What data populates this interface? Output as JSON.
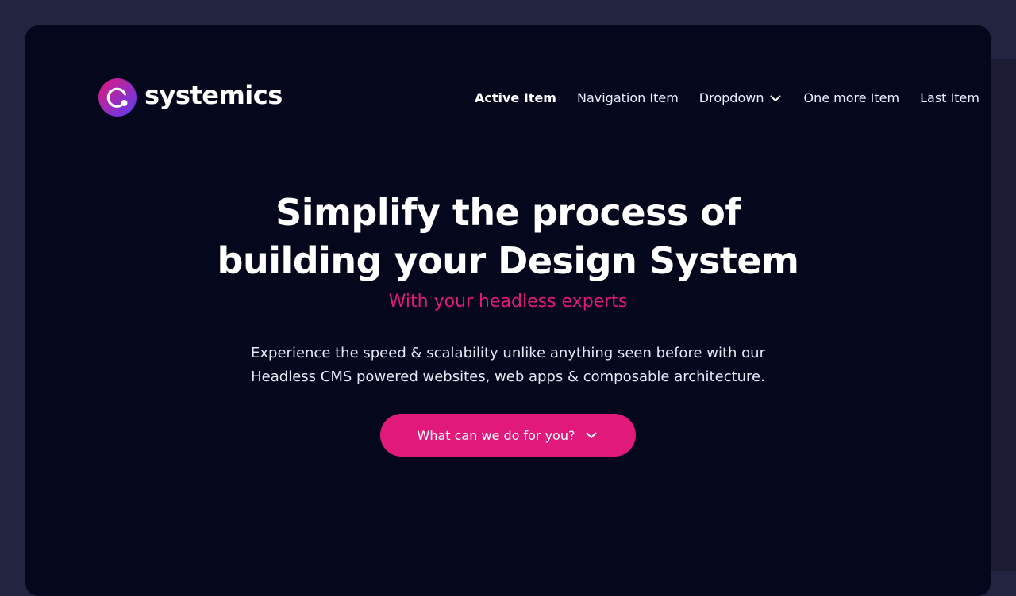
{
  "brand": {
    "name": "systemics",
    "accent_color": "#e0197a",
    "logo_gradient": [
      "#e0197a",
      "#5b3df5"
    ]
  },
  "nav": {
    "items": [
      {
        "label": "Active Item",
        "active": true
      },
      {
        "label": "Navigation Item",
        "active": false
      },
      {
        "label": "Dropdown",
        "active": false,
        "icon": "chevron-down-icon"
      },
      {
        "label": "One more Item",
        "active": false
      },
      {
        "label": "Last Item",
        "active": false
      }
    ]
  },
  "hero": {
    "title_line_1": "Simplify the process of",
    "title_line_2": "building your Design System",
    "subtitle": "With your headless experts",
    "body_line_1": "Experience the speed & scalability unlike anything seen before with our",
    "body_line_2": "Headless CMS powered websites, web apps & composable architecture.",
    "cta_label": "What can we do for you?",
    "cta_icon": "chevron-down-icon"
  },
  "colors": {
    "page_background": "#232440",
    "panel_background": "#05081d",
    "text": "#ffffff"
  }
}
